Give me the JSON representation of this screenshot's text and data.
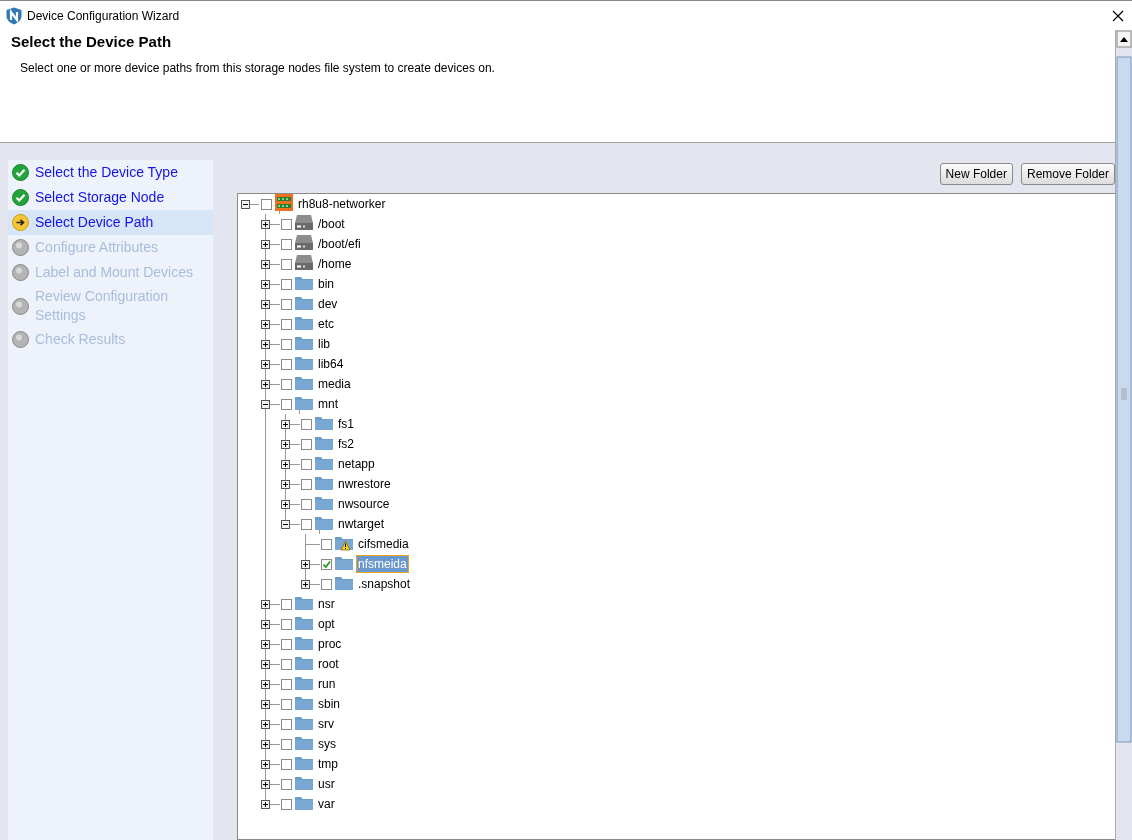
{
  "window": {
    "title": "Device Configuration Wizard"
  },
  "header": {
    "title": "Select the Device Path",
    "description": "Select one or more device paths from this storage nodes file system to create devices on."
  },
  "steps": [
    {
      "label": "Select the Device Type",
      "kind": "done",
      "selected": false
    },
    {
      "label": "Select Storage Node",
      "kind": "done",
      "selected": false
    },
    {
      "label": "Select Device Path",
      "kind": "current",
      "selected": true
    },
    {
      "label": "Configure Attributes",
      "kind": "pending",
      "selected": false
    },
    {
      "label": "Label and Mount Devices",
      "kind": "pending",
      "selected": false
    },
    {
      "label": "Review Configuration Settings",
      "kind": "pending",
      "selected": false
    },
    {
      "label": "Check Results",
      "kind": "pending",
      "selected": false
    }
  ],
  "buttons": [
    "New Folder",
    "Remove Folder"
  ],
  "tree": {
    "label": "rh8u8-networker",
    "kind": "server",
    "expandable": true,
    "expanded": true,
    "checked": false,
    "selected": false,
    "children": [
      {
        "label": "/boot",
        "kind": "drive",
        "expandable": true,
        "expanded": false,
        "checked": false,
        "selected": false
      },
      {
        "label": "/boot/efi",
        "kind": "drive",
        "expandable": true,
        "expanded": false,
        "checked": false,
        "selected": false
      },
      {
        "label": "/home",
        "kind": "drive",
        "expandable": true,
        "expanded": false,
        "checked": false,
        "selected": false
      },
      {
        "label": "bin",
        "kind": "folder",
        "expandable": true,
        "expanded": false,
        "checked": false,
        "selected": false
      },
      {
        "label": "dev",
        "kind": "folder",
        "expandable": true,
        "expanded": false,
        "checked": false,
        "selected": false
      },
      {
        "label": "etc",
        "kind": "folder",
        "expandable": true,
        "expanded": false,
        "checked": false,
        "selected": false
      },
      {
        "label": "lib",
        "kind": "folder",
        "expandable": true,
        "expanded": false,
        "checked": false,
        "selected": false
      },
      {
        "label": "lib64",
        "kind": "folder",
        "expandable": true,
        "expanded": false,
        "checked": false,
        "selected": false
      },
      {
        "label": "media",
        "kind": "folder",
        "expandable": true,
        "expanded": false,
        "checked": false,
        "selected": false
      },
      {
        "label": "mnt",
        "kind": "folder",
        "expandable": true,
        "expanded": true,
        "checked": false,
        "selected": false,
        "children": [
          {
            "label": "fs1",
            "kind": "folder",
            "expandable": true,
            "expanded": false,
            "checked": false,
            "selected": false
          },
          {
            "label": "fs2",
            "kind": "folder",
            "expandable": true,
            "expanded": false,
            "checked": false,
            "selected": false
          },
          {
            "label": "netapp",
            "kind": "folder",
            "expandable": true,
            "expanded": false,
            "checked": false,
            "selected": false
          },
          {
            "label": "nwrestore",
            "kind": "folder",
            "expandable": true,
            "expanded": false,
            "checked": false,
            "selected": false
          },
          {
            "label": "nwsource",
            "kind": "folder",
            "expandable": true,
            "expanded": false,
            "checked": false,
            "selected": false
          },
          {
            "label": "nwtarget",
            "kind": "folder",
            "expandable": true,
            "expanded": true,
            "checked": false,
            "selected": false,
            "children": [
              {
                "label": "cifsmedia",
                "kind": "folder-warning",
                "expandable": false,
                "expanded": false,
                "checked": false,
                "selected": false
              },
              {
                "label": "nfsmeida",
                "kind": "folder",
                "expandable": true,
                "expanded": false,
                "checked": true,
                "selected": true
              },
              {
                "label": ".snapshot",
                "kind": "folder",
                "expandable": true,
                "expanded": false,
                "checked": false,
                "selected": false
              }
            ]
          }
        ]
      },
      {
        "label": "nsr",
        "kind": "folder",
        "expandable": true,
        "expanded": false,
        "checked": false,
        "selected": false
      },
      {
        "label": "opt",
        "kind": "folder",
        "expandable": true,
        "expanded": false,
        "checked": false,
        "selected": false
      },
      {
        "label": "proc",
        "kind": "folder",
        "expandable": true,
        "expanded": false,
        "checked": false,
        "selected": false
      },
      {
        "label": "root",
        "kind": "folder",
        "expandable": true,
        "expanded": false,
        "checked": false,
        "selected": false
      },
      {
        "label": "run",
        "kind": "folder",
        "expandable": true,
        "expanded": false,
        "checked": false,
        "selected": false
      },
      {
        "label": "sbin",
        "kind": "folder",
        "expandable": true,
        "expanded": false,
        "checked": false,
        "selected": false
      },
      {
        "label": "srv",
        "kind": "folder",
        "expandable": true,
        "expanded": false,
        "checked": false,
        "selected": false
      },
      {
        "label": "sys",
        "kind": "folder",
        "expandable": true,
        "expanded": false,
        "checked": false,
        "selected": false
      },
      {
        "label": "tmp",
        "kind": "folder",
        "expandable": true,
        "expanded": false,
        "checked": false,
        "selected": false
      },
      {
        "label": "usr",
        "kind": "folder",
        "expandable": true,
        "expanded": false,
        "checked": false,
        "selected": false
      },
      {
        "label": "var",
        "kind": "folder",
        "expandable": true,
        "expanded": false,
        "checked": false,
        "selected": false
      }
    ]
  }
}
